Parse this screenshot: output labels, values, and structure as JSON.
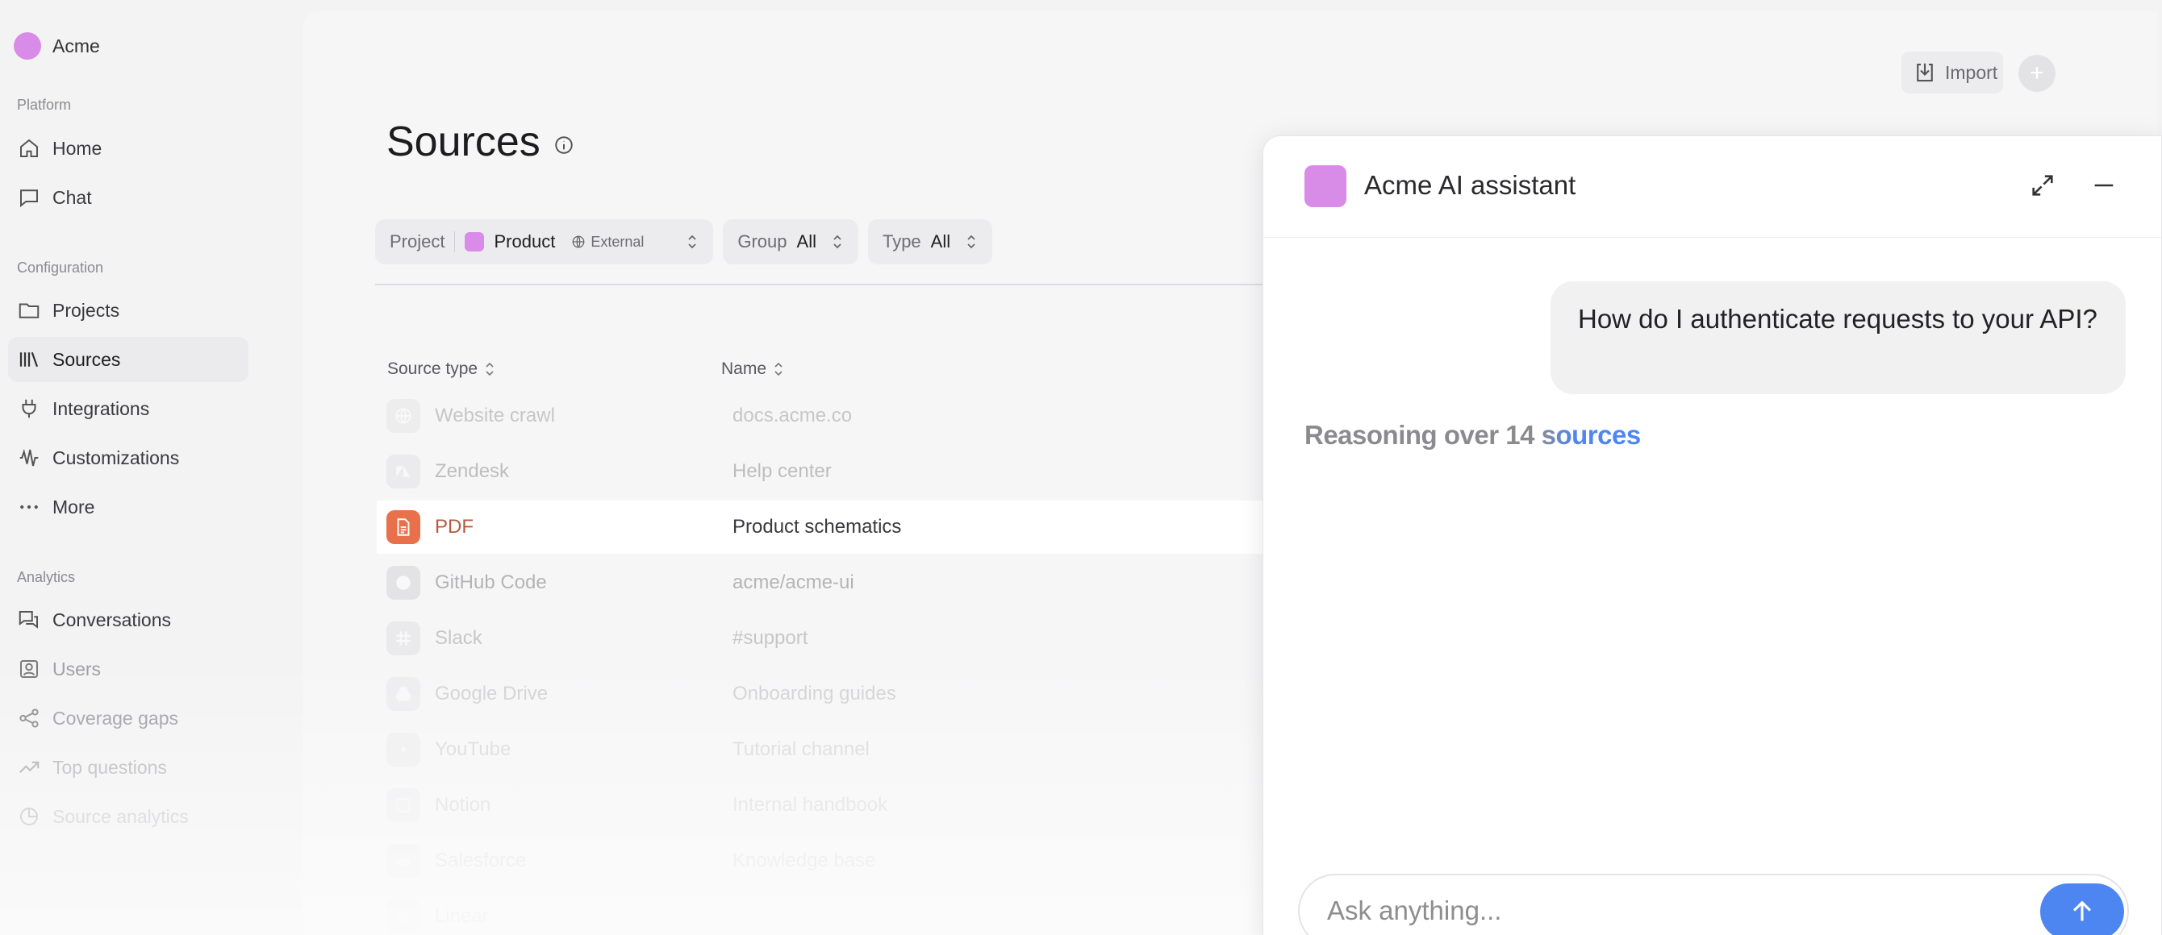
{
  "brand": {
    "name": "Acme"
  },
  "sidebar": {
    "sections": {
      "platform": "Platform",
      "configuration": "Configuration",
      "analytics": "Analytics"
    },
    "items": [
      {
        "label": "Home",
        "icon": "home-icon"
      },
      {
        "label": "Chat",
        "icon": "chat-icon"
      },
      {
        "label": "Projects",
        "icon": "folder-icon"
      },
      {
        "label": "Sources",
        "icon": "library-icon",
        "active": true
      },
      {
        "label": "Integrations",
        "icon": "plug-icon"
      },
      {
        "label": "Customizations",
        "icon": "waveform-icon"
      },
      {
        "label": "More",
        "icon": "more-dots-icon"
      },
      {
        "label": "Conversations",
        "icon": "conversations-icon"
      },
      {
        "label": "Users",
        "icon": "user-icon"
      },
      {
        "label": "Coverage gaps",
        "icon": "share-nodes-icon"
      },
      {
        "label": "Top questions",
        "icon": "trending-icon"
      },
      {
        "label": "Source analytics",
        "icon": "pie-chart-icon"
      }
    ]
  },
  "toolbar": {
    "import_label": "Import",
    "plus_label": "+"
  },
  "page": {
    "title": "Sources"
  },
  "filters": {
    "project": {
      "label": "Project",
      "value": "Product",
      "badge": "External"
    },
    "group": {
      "label": "Group",
      "value": "All"
    },
    "type": {
      "label": "Type",
      "value": "All"
    }
  },
  "table": {
    "columns": [
      "Source type",
      "Name"
    ],
    "rows": [
      {
        "type": "Website crawl",
        "name": "docs.acme.co",
        "icon": "globe-icon"
      },
      {
        "type": "Zendesk",
        "name": "Help center",
        "icon": "zendesk-icon"
      },
      {
        "type": "PDF",
        "name": "Product schematics",
        "icon": "pdf-document-icon",
        "highlight": true
      },
      {
        "type": "GitHub Code",
        "name": "acme/acme-ui",
        "icon": "github-icon"
      },
      {
        "type": "Slack",
        "name": "#support",
        "icon": "slack-icon"
      },
      {
        "type": "Google Drive",
        "name": "Onboarding guides",
        "icon": "drive-icon"
      },
      {
        "type": "YouTube",
        "name": "Tutorial channel",
        "icon": "youtube-icon"
      },
      {
        "type": "Notion",
        "name": "Internal handbook",
        "icon": "notion-icon"
      },
      {
        "type": "Salesforce",
        "name": "Knowledge base",
        "icon": "salesforce-icon"
      },
      {
        "type": "Linear",
        "name": "",
        "icon": "linear-icon"
      }
    ]
  },
  "assistant": {
    "title": "Acme AI assistant",
    "user_message": "How do I authenticate requests to your API?",
    "status": "Reasoning over 14 sources",
    "input_placeholder": "Ask anything..."
  },
  "colors": {
    "brand": "#d98be8",
    "accent": "#4d86f1",
    "pdf": "#e8704a"
  }
}
